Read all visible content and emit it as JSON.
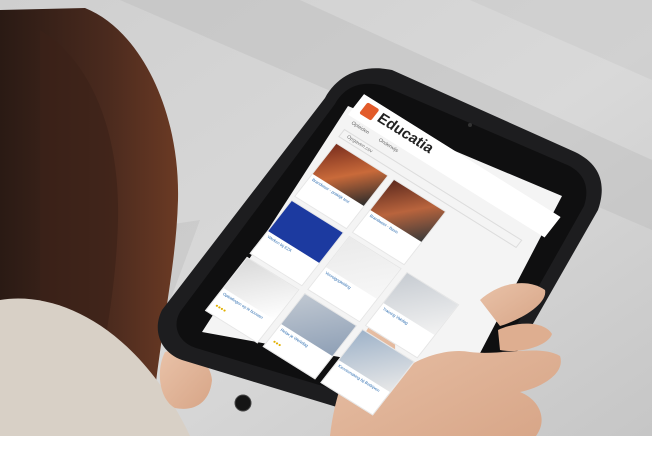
{
  "app": {
    "brand": "Educatia"
  },
  "nav": [
    "Opleiden",
    "Onderwijs"
  ],
  "search": {
    "placeholder": "Opgaven.csv"
  },
  "tiles": [
    {
      "title": "Brandweer - praktijk test",
      "stars": ""
    },
    {
      "title": "Brandweer - Basis",
      "stars": ""
    },
    {
      "title": "Werken bij EZK",
      "stars": ""
    },
    {
      "title": "Vervolgopleiding",
      "stars": ""
    },
    {
      "title": "Opleidingen op te bouwen",
      "stars": "●●●●"
    },
    {
      "title": "Relax je Werkdag",
      "stars": "●●●"
    },
    {
      "title": "Kennismaking bij Bedrijven",
      "stars": ""
    },
    {
      "title": "Training Vakdag",
      "stars": ""
    }
  ],
  "colors": {
    "brand": "#e25b2a",
    "link": "#2b6cb0",
    "rating": "#e2b000"
  }
}
